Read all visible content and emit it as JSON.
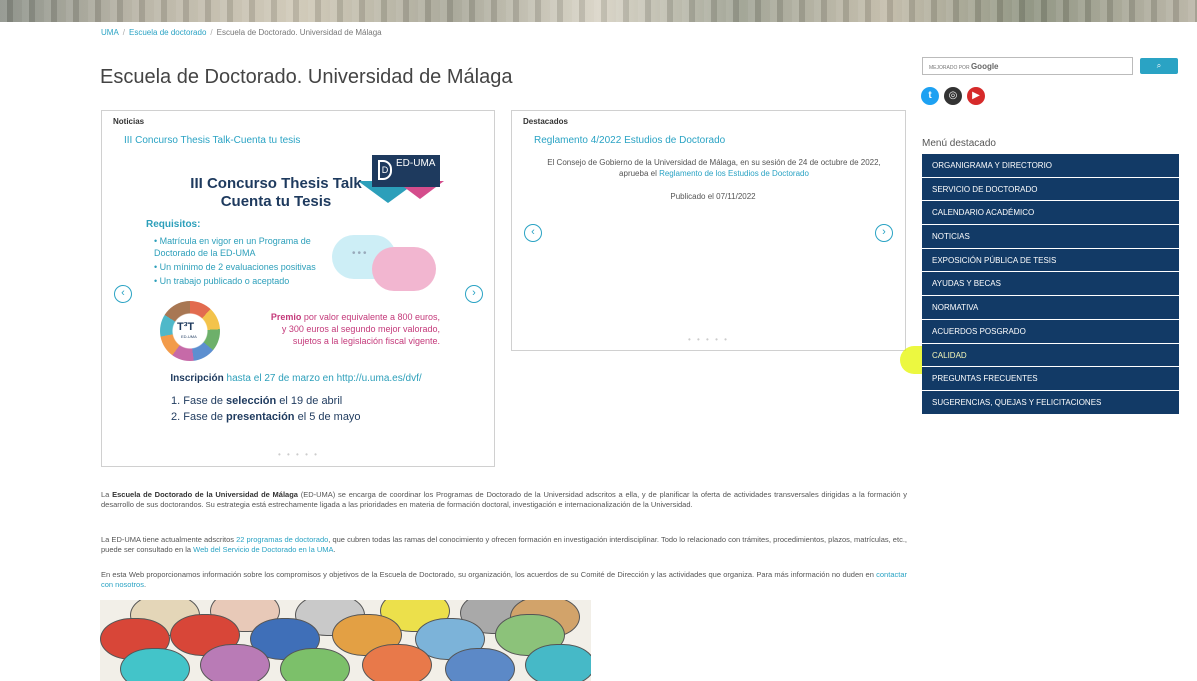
{
  "breadcrumb": {
    "items": [
      "UMA",
      "Escuela de doctorado",
      "Escuela de Doctorado. Universidad de Málaga"
    ],
    "separator": "/"
  },
  "page_title": "Escuela de Doctorado. Universidad de Málaga",
  "noticias": {
    "heading": "Noticias",
    "link": "III Concurso Thesis Talk-Cuenta tu tesis",
    "poster": {
      "logo_text": "ED-UMA",
      "logo_subtext": "Escuela de Doctorado UNIVERSIDAD DE MÁLAGA",
      "title_line1": "III Concurso Thesis Talk",
      "title_line2": "Cuenta tu Tesis",
      "requisitos_title": "Requisitos:",
      "requisitos": [
        "• Matrícula en vigor en un Programa de",
        "   Doctorado de la ED-UMA",
        "• Un mínimo de 2 evaluaciones positivas",
        "• Un trabajo publicado o aceptado"
      ],
      "t3t_label": "T³T",
      "t3t_sub": "ED-UMA",
      "premio_bold": "Premio",
      "premio_rest": " por valor equivalente a 800 euros,",
      "premio_line2": "y 300 euros al segundo mejor valorado,",
      "premio_line3": "sujetos a la legislación fiscal vigente.",
      "inscripcion_bold": "Inscripción",
      "inscripcion_rest": " hasta el 27 de marzo en http://u.uma.es/dvf/",
      "fase1_pre": "1. Fase de ",
      "fase1_bold": "selección",
      "fase1_post": "  el 19 de abril",
      "fase2_pre": "2. Fase de ",
      "fase2_bold": "presentación",
      "fase2_post": " el 5 de mayo"
    },
    "dots": "• • • • •"
  },
  "destacados": {
    "heading": "Destacados",
    "link": "Reglamento 4/2022 Estudios de Doctorado",
    "text_pre": "El Consejo de Gobierno de la Universidad de Málaga, en su sesión de 24 de octubre de 2022, aprueba el ",
    "text_link": "Reglamento de los Estudios de Doctorado",
    "published": "Publicado el 07/11/2022",
    "dots": "• • • • •"
  },
  "body": {
    "p1_bold": "Escuela de Doctorado de la Universidad de Málaga",
    "p1_pre": "La ",
    "p1_rest": " (ED-UMA) se encarga de coordinar los Programas de Doctorado de la Universidad adscritos a ella, y de planificar la oferta de actividades transversales dirigidas a la formación y desarrollo de sus doctorandos. Su estrategia está estrechamente ligada a las prioridades en materia de formación doctoral, investigación e internacionalización de la Universidad.",
    "p2_pre": "La ED-UMA tiene actualmente adscritos ",
    "p2_link": "22 programas de doctorado",
    "p2_mid": ", que cubren todas las ramas del conocimiento y ofrecen formación en investigación interdisciplinar. Todo lo relacionado con trámites, procedimientos, plazos, matrículas, etc., puede ser consultado en la ",
    "p2_link2": "Web del Servicio de Doctorado en la UMA",
    "p2_end": ".",
    "p3_pre": "En esta Web proporcionamos información sobre los compromisos y objetivos de la Escuela de Doctorado, su organización, los acuerdos de su Comité de Dirección y las actividades que organiza. Para más información no duden en ",
    "p3_link": "contactar con nosotros",
    "p3_end": "."
  },
  "search": {
    "placeholder_small": "MEJORADO POR ",
    "placeholder_brand": "Google",
    "button_icon": "search-icon"
  },
  "social": [
    {
      "name": "twitter-icon",
      "color": "#1da1f2",
      "glyph": "t"
    },
    {
      "name": "instagram-icon",
      "color": "#333333",
      "glyph": "◎"
    },
    {
      "name": "youtube-icon",
      "color": "#d62a2a",
      "glyph": "▶"
    }
  ],
  "menu": {
    "title": "Menú destacado",
    "items": [
      "ORGANIGRAMA Y DIRECTORIO",
      "SERVICIO DE DOCTORADO",
      "CALENDARIO ACADÉMICO",
      "NOTICIAS",
      "EXPOSICIÓN PÚBLICA DE TESIS",
      "AYUDAS Y BECAS",
      "NORMATIVA",
      "ACUERDOS POSGRADO",
      "CALIDAD",
      "PREGUNTAS FRECUENTES",
      "SUGERENCIAS, QUEJAS Y FELICITACIONES"
    ],
    "highlighted": "CALIDAD"
  },
  "colors": {
    "menu_bg": "#123a66",
    "link": "#2aa3c4",
    "highlight": "#e6f500"
  }
}
